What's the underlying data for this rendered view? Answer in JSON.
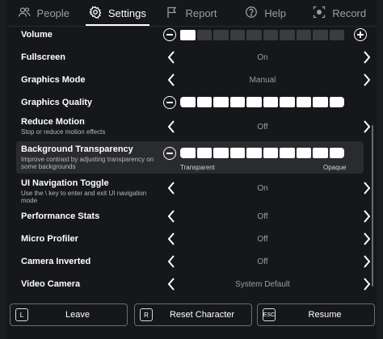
{
  "tabs": [
    {
      "label": "People",
      "icon": "people-icon",
      "active": false
    },
    {
      "label": "Settings",
      "icon": "gear-icon",
      "active": true
    },
    {
      "label": "Report",
      "icon": "flag-icon",
      "active": false
    },
    {
      "label": "Help",
      "icon": "help-icon",
      "active": false
    },
    {
      "label": "Record",
      "icon": "record-icon",
      "active": false
    }
  ],
  "settings": {
    "volume": {
      "label": "Volume",
      "level": 1,
      "max": 10
    },
    "fullscreen": {
      "label": "Fullscreen",
      "value": "On"
    },
    "graphics_mode": {
      "label": "Graphics Mode",
      "value": "Manual"
    },
    "graphics_quality": {
      "label": "Graphics Quality",
      "level": 10,
      "max": 10
    },
    "reduce_motion": {
      "label": "Reduce Motion",
      "description": "Stop or reduce motion effects",
      "value": "Off"
    },
    "background_transparency": {
      "label": "Background Transparency",
      "description": "Improve contrast by adjusting transparency on some backgrounds",
      "level": 10,
      "max": 10,
      "min_label": "Transparent",
      "max_label": "Opaque"
    },
    "ui_navigation_toggle": {
      "label": "UI Navigation Toggle",
      "description": "Use the \\ key to enter and exit UI navigation mode",
      "value": "On"
    },
    "performance_stats": {
      "label": "Performance Stats",
      "value": "Off"
    },
    "micro_profiler": {
      "label": "Micro Profiler",
      "value": "Off"
    },
    "camera_inverted": {
      "label": "Camera Inverted",
      "value": "Off"
    },
    "video_camera": {
      "label": "Video Camera",
      "value": "System Default"
    }
  },
  "bottom": {
    "leave": {
      "key": "L",
      "label": "Leave"
    },
    "reset": {
      "key": "R",
      "label": "Reset Character"
    },
    "resume": {
      "key": "ESC",
      "label": "Resume"
    }
  },
  "colors": {
    "background": "#16171a",
    "highlight": "#2a2b2f",
    "segment_on": "#ffffff",
    "segment_off": "#3b3c40",
    "muted_text": "#9b9ea3"
  }
}
